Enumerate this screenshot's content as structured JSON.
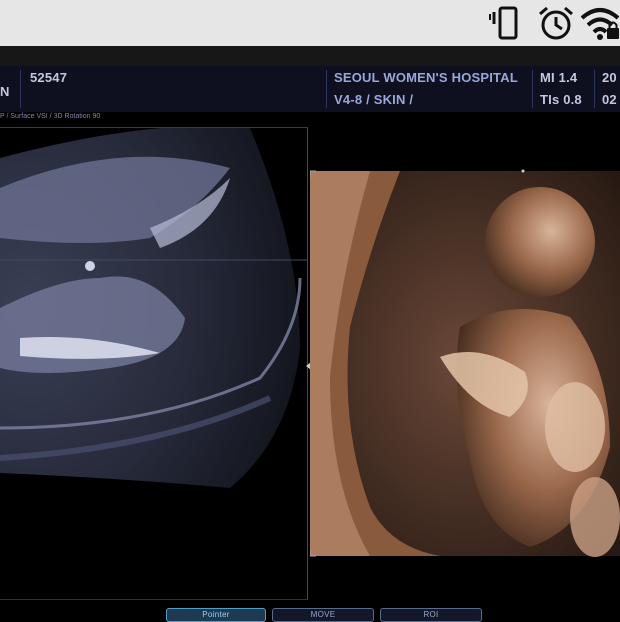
{
  "status_bar": {
    "icons": [
      "vibrate-icon",
      "alarm-clock-icon",
      "wifi-locked-icon"
    ]
  },
  "header": {
    "left_label": "N",
    "patient_id": "52547",
    "hospital": "SEOUL WOMEN'S HOSPITAL",
    "probe_preset": "V4-8 / SKIN /",
    "mi": "MI  1.4",
    "tis": "TIs 0.8",
    "date_top": "20",
    "date_bottom": "02"
  },
  "subline": {
    "text": "P / Surface VSI / 3D Rotation 90"
  },
  "images": {
    "left_panel": "2d-sonogram",
    "right_panel": "3d-surface-render"
  },
  "soft_buttons": [
    {
      "label": "Pointer",
      "active": true
    },
    {
      "label": "MOVE",
      "active": false
    },
    {
      "label": "ROI",
      "active": false
    }
  ],
  "colors": {
    "header_bg": "#0e1020",
    "header_text": "#9aa7d8",
    "status_bar_bg": "#e6e6e6",
    "render_tint": "#8a5a3c"
  }
}
